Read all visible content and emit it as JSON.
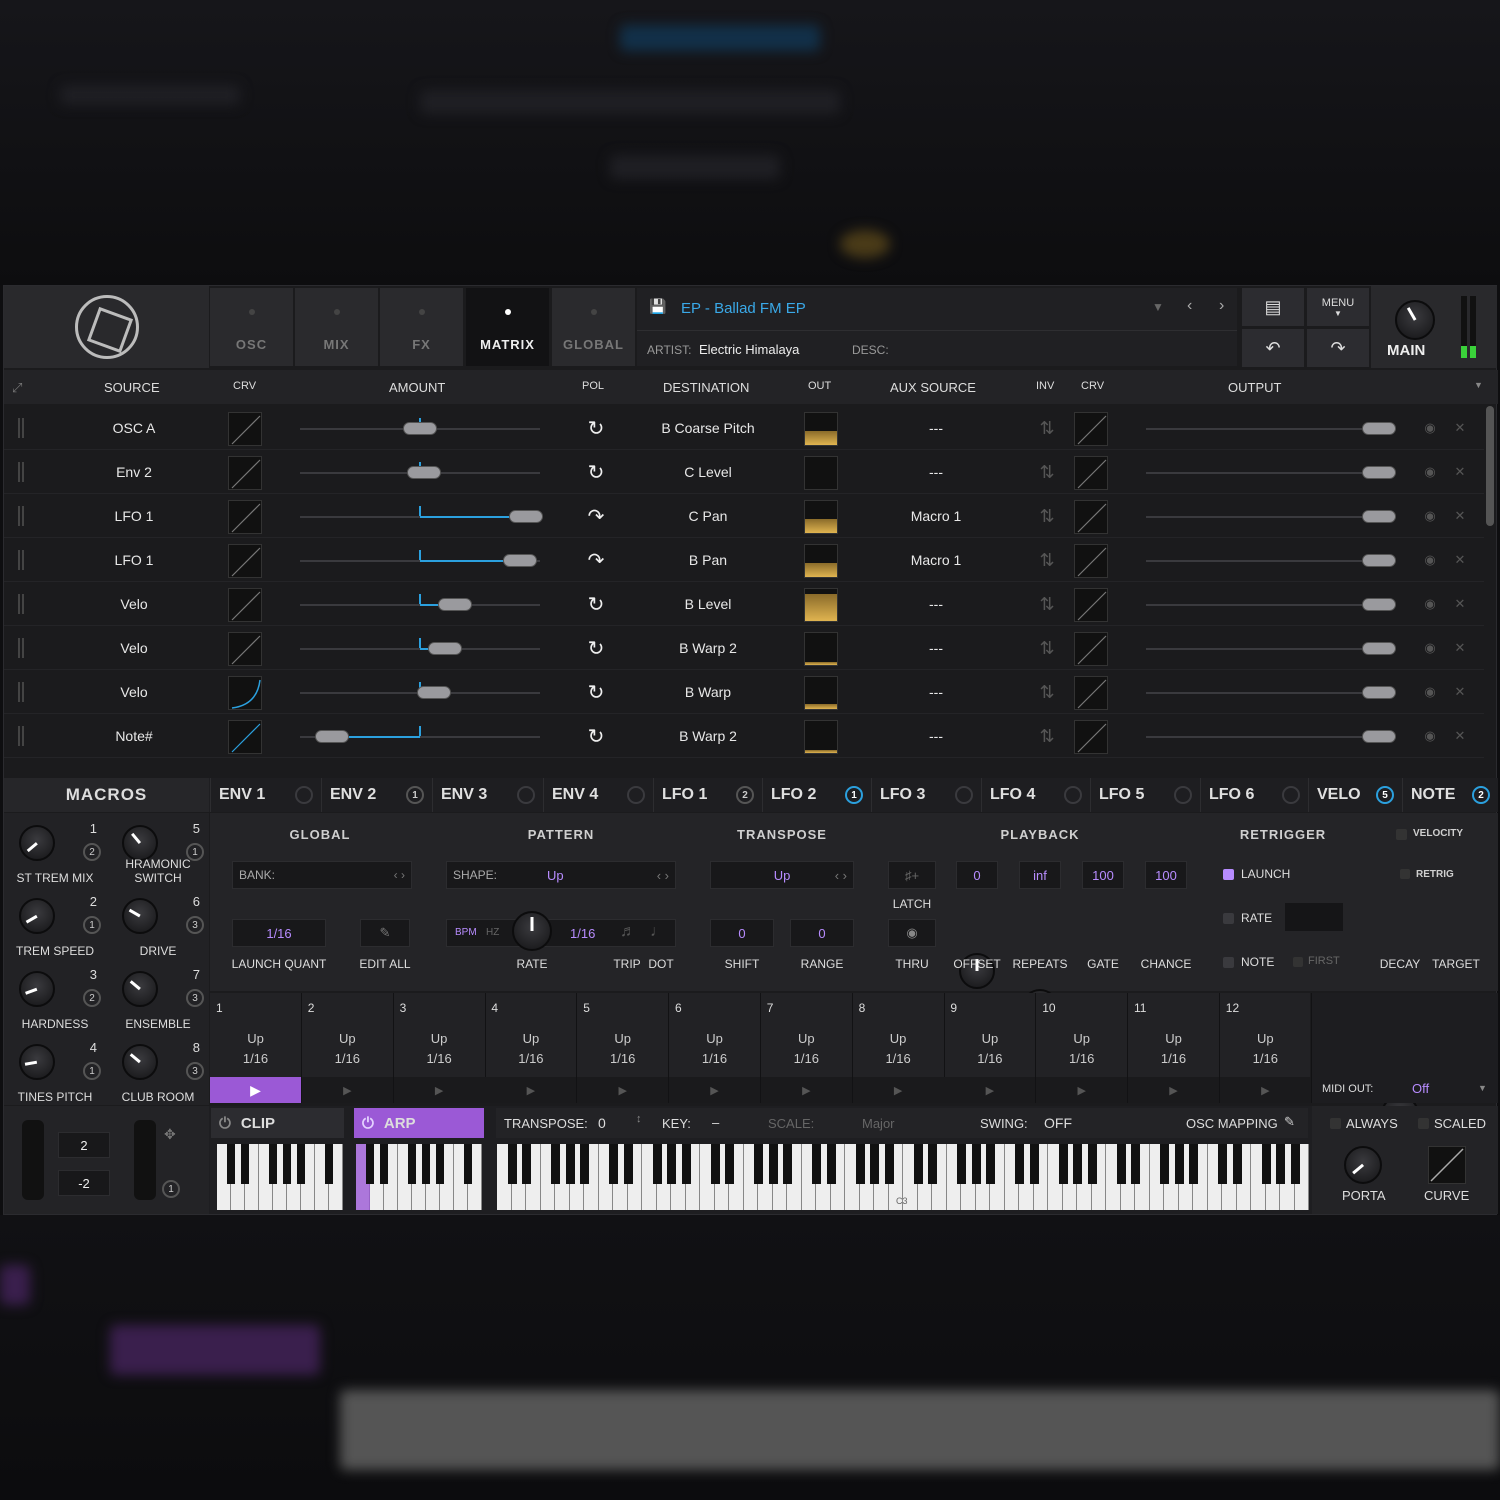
{
  "tabs": [
    {
      "label": "OSC"
    },
    {
      "label": "MIX"
    },
    {
      "label": "FX"
    },
    {
      "label": "MATRIX"
    },
    {
      "label": "GLOBAL"
    }
  ],
  "preset": {
    "name": "EP - Ballad FM EP",
    "artist_label": "ARTIST:",
    "artist": "Electric Himalaya",
    "desc_label": "DESC:",
    "desc": ""
  },
  "header": {
    "menu_label": "MENU",
    "main_label": "MAIN"
  },
  "matrix": {
    "columns": {
      "source": "SOURCE",
      "crv": "CRV",
      "amount": "AMOUNT",
      "pol": "POL",
      "destination": "DESTINATION",
      "out": "OUT",
      "aux_source": "AUX SOURCE",
      "inv": "INV",
      "crv2": "CRV",
      "output": "OUTPUT"
    },
    "rows": [
      {
        "source": "OSC A",
        "amount": 0,
        "destination": "B Coarse Pitch",
        "out_level": 0.45,
        "aux": "---"
      },
      {
        "source": "Env 2",
        "amount": 0.03,
        "destination": "C Level",
        "out_level": 0,
        "aux": "---"
      },
      {
        "source": "LFO 1",
        "amount": 0.88,
        "destination": "C Pan",
        "out_level": 0.45,
        "aux": "Macro 1"
      },
      {
        "source": "LFO 1",
        "amount": 0.83,
        "destination": "B Pan",
        "out_level": 0.45,
        "aux": "Macro 1"
      },
      {
        "source": "Velo",
        "amount": 0.29,
        "destination": "B Level",
        "out_level": 0.85,
        "aux": "---"
      },
      {
        "source": "Velo",
        "amount": 0.21,
        "destination": "B Warp 2",
        "out_level": 0.1,
        "aux": "---"
      },
      {
        "source": "Velo",
        "amount": 0.12,
        "destination": "B Warp",
        "out_level": 0.15,
        "aux": "---"
      },
      {
        "source": "Note#",
        "amount": -0.73,
        "destination": "B Warp 2",
        "out_level": 0.1,
        "aux": "---"
      }
    ]
  },
  "mod_tabs": [
    {
      "label": "ENV 1",
      "badge": ""
    },
    {
      "label": "ENV 2",
      "badge": "1"
    },
    {
      "label": "ENV 3",
      "badge": ""
    },
    {
      "label": "ENV 4",
      "badge": ""
    },
    {
      "label": "LFO 1",
      "badge": "2"
    },
    {
      "label": "LFO 2",
      "badge": "1"
    },
    {
      "label": "LFO 3",
      "badge": ""
    },
    {
      "label": "LFO 4",
      "badge": ""
    },
    {
      "label": "LFO 5",
      "badge": ""
    },
    {
      "label": "LFO 6",
      "badge": ""
    },
    {
      "label": "VELO",
      "badge": "5"
    },
    {
      "label": "NOTE",
      "badge": "2"
    }
  ],
  "macros": {
    "title": "MACROS",
    "items": [
      {
        "num": "1",
        "count": "2",
        "label": "ST TREM MIX"
      },
      {
        "num": "5",
        "count": "1",
        "label": "HRAMONIC SWITCH"
      },
      {
        "num": "2",
        "count": "1",
        "label": "TREM SPEED"
      },
      {
        "num": "6",
        "count": "3",
        "label": "DRIVE"
      },
      {
        "num": "3",
        "count": "2",
        "label": "HARDNESS"
      },
      {
        "num": "7",
        "count": "3",
        "label": "ENSEMBLE"
      },
      {
        "num": "4",
        "count": "1",
        "label": "TINES PITCH"
      },
      {
        "num": "8",
        "count": "3",
        "label": "CLUB ROOM"
      }
    ]
  },
  "arp": {
    "global": {
      "title": "GLOBAL",
      "bank_label": "BANK:",
      "bank": "",
      "launch_quant": "1/16",
      "launch_quant_label": "LAUNCH QUANT",
      "edit_all_label": "EDIT ALL"
    },
    "pattern": {
      "title": "PATTERN",
      "shape_label": "SHAPE:",
      "shape": "Up",
      "bpm": "BPM",
      "hz": "HZ",
      "rate": "1/16",
      "rate_label": "RATE",
      "trip_label": "TRIP",
      "dot_label": "DOT"
    },
    "transpose": {
      "title": "TRANSPOSE",
      "mode": "Up",
      "shift": "0",
      "range": "0",
      "shift_label": "SHIFT",
      "range_label": "RANGE"
    },
    "playback": {
      "title": "PLAYBACK",
      "latch_label": "LATCH",
      "thru_label": "THRU",
      "offset": "0",
      "repeats": "inf",
      "gate": "100",
      "chance": "100",
      "offset_label": "OFFSET",
      "repeats_label": "REPEATS",
      "gate_label": "GATE",
      "chance_label": "CHANCE"
    },
    "retrigger": {
      "title": "RETRIGGER",
      "launch": "LAUNCH",
      "rate": "RATE",
      "note": "NOTE",
      "first": "FIRST"
    },
    "velocity": {
      "title": "VELOCITY",
      "retrig": "RETRIG",
      "decay_label": "DECAY",
      "target_label": "TARGET"
    }
  },
  "steps": [
    {
      "n": "1",
      "dir": "Up",
      "rate": "1/16"
    },
    {
      "n": "2",
      "dir": "Up",
      "rate": "1/16"
    },
    {
      "n": "3",
      "dir": "Up",
      "rate": "1/16"
    },
    {
      "n": "4",
      "dir": "Up",
      "rate": "1/16"
    },
    {
      "n": "5",
      "dir": "Up",
      "rate": "1/16"
    },
    {
      "n": "6",
      "dir": "Up",
      "rate": "1/16"
    },
    {
      "n": "7",
      "dir": "Up",
      "rate": "1/16"
    },
    {
      "n": "8",
      "dir": "Up",
      "rate": "1/16"
    },
    {
      "n": "9",
      "dir": "Up",
      "rate": "1/16"
    },
    {
      "n": "10",
      "dir": "Up",
      "rate": "1/16"
    },
    {
      "n": "11",
      "dir": "Up",
      "rate": "1/16"
    },
    {
      "n": "12",
      "dir": "Up",
      "rate": "1/16"
    }
  ],
  "midi_out": {
    "label": "MIDI OUT:",
    "value": "Off"
  },
  "bottom": {
    "pitch_up": "2",
    "pitch_down": "-2",
    "mod_badge": "1",
    "clip_label": "CLIP",
    "arp_label": "ARP",
    "transpose_label": "TRANSPOSE:",
    "transpose": "0",
    "key_label": "KEY:",
    "key": "–",
    "scale_label": "SCALE:",
    "scale": "Major",
    "swing_label": "SWING:",
    "swing": "OFF",
    "osc_mapping": "OSC MAPPING",
    "c3": "C3",
    "always": "ALWAYS",
    "scaled": "SCALED",
    "porta": "PORTA",
    "curve": "CURVE"
  },
  "colors": {
    "accent_blue": "#2ba0de",
    "accent_purple": "#9b59d6",
    "gold": "#e0b450"
  }
}
